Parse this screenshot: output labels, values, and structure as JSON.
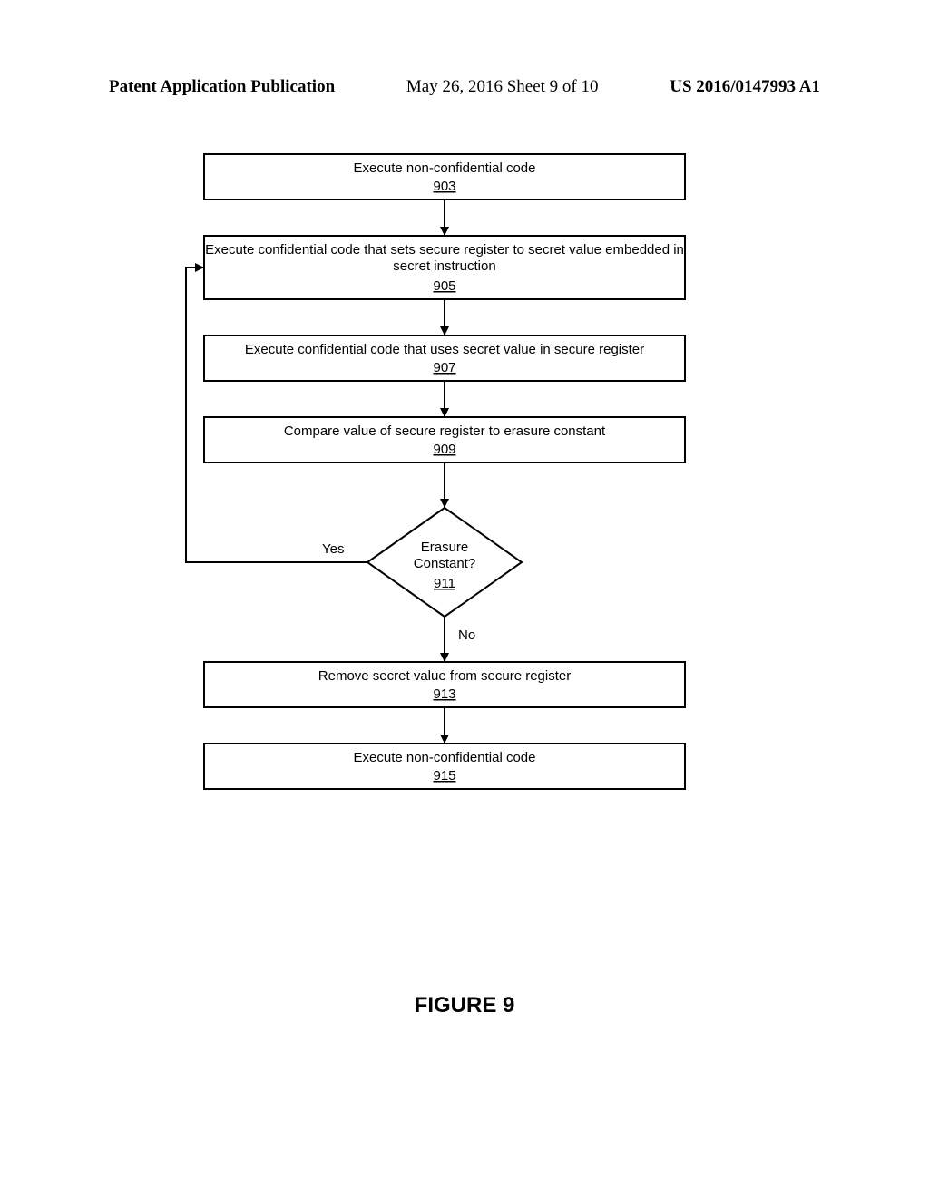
{
  "header": {
    "left": "Patent Application Publication",
    "mid": "May 26, 2016  Sheet 9 of 10",
    "right": "US 2016/0147993 A1"
  },
  "chart_data": {
    "type": "flowchart",
    "figure_caption": "FIGURE 9",
    "nodes": [
      {
        "id": "903",
        "shape": "process",
        "label": "Execute non-confidential code",
        "ref": "903"
      },
      {
        "id": "905",
        "shape": "process",
        "label": "Execute confidential code that sets secure register to secret value embedded in secret instruction",
        "ref": "905"
      },
      {
        "id": "907",
        "shape": "process",
        "label": "Execute confidential  code that uses secret value in secure register",
        "ref": "907"
      },
      {
        "id": "909",
        "shape": "process",
        "label": "Compare value of secure register to erasure constant",
        "ref": "909"
      },
      {
        "id": "911",
        "shape": "decision",
        "label": "Erasure Constant?",
        "ref": "911"
      },
      {
        "id": "913",
        "shape": "process",
        "label": "Remove secret value from secure register",
        "ref": "913"
      },
      {
        "id": "915",
        "shape": "process",
        "label": "Execute non-confidential code",
        "ref": "915"
      }
    ],
    "edges": [
      {
        "from": "903",
        "to": "905",
        "label": ""
      },
      {
        "from": "905",
        "to": "907",
        "label": ""
      },
      {
        "from": "907",
        "to": "909",
        "label": ""
      },
      {
        "from": "909",
        "to": "911",
        "label": ""
      },
      {
        "from": "911",
        "to": "905",
        "label": "Yes"
      },
      {
        "from": "911",
        "to": "913",
        "label": "No"
      },
      {
        "from": "913",
        "to": "915",
        "label": ""
      }
    ]
  }
}
